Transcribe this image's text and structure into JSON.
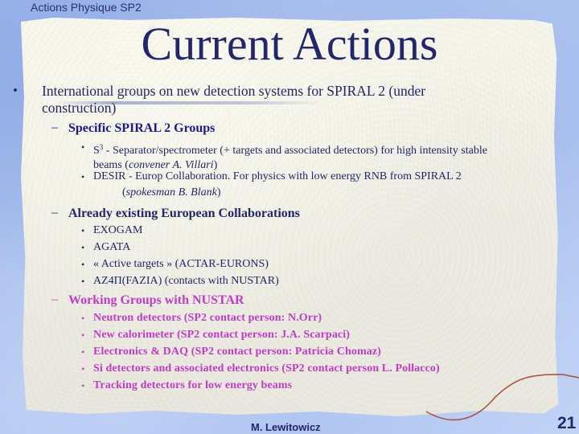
{
  "header": {
    "label": "Actions Physique SP2"
  },
  "title": "Current Actions",
  "main": {
    "bullet": "International groups on new detection systems for SPIRAL 2 (under construction)",
    "bullet_line1": "International groups on new detection systems for SPIRAL 2 (under",
    "bullet_line2": "construction)",
    "sections": [
      {
        "heading": "Specific SPIRAL 2 Groups",
        "color": "#1a1a8c",
        "items": [
          {
            "prefix": "S",
            "sup": "3",
            "text_line1": " - Separator/spectrometer (+ targets and associated detectors) for high intensity stable",
            "text_line2_plain": "beams (",
            "text_line2_italic": "convener A. Villari",
            "text_line2_end": ")"
          },
          {
            "text_line1": "DESIR - Europ Collaboration. For physics with low energy RNB from SPIRAL 2",
            "text_line2_plain": "(",
            "text_line2_italic": "spokesman B. Blank",
            "text_line2_end": ")"
          }
        ]
      },
      {
        "heading": "Already existing European Collaborations",
        "color": "#22266b",
        "items": [
          {
            "text": "EXOGAM"
          },
          {
            "text": "AGATA"
          },
          {
            "text": "« Active targets » (ACTAR-EURONS)"
          },
          {
            "text": "AZ4Π(FAZIA) (contacts with NUSTAR)"
          }
        ]
      },
      {
        "heading": "Working Groups with NUSTAR",
        "color": "#c23cc4",
        "items": [
          {
            "text": "Neutron detectors (SP2 contact person: N.Orr)"
          },
          {
            "text": "New calorimeter (SP2 contact person: J.A. Scarpaci)"
          },
          {
            "text": "Electronics & DAQ (SP2 contact person: Patricia Chomaz)"
          },
          {
            "text": "Si detectors and associated electronics (SP2 contact person  L. Pollacco)"
          },
          {
            "text": "Tracking detectors for low energy beams"
          }
        ]
      }
    ]
  },
  "glyphs": {
    "bullet": "•",
    "dash": "–"
  },
  "footer": {
    "author": "M. Lewitowicz",
    "page_number": "21"
  },
  "colors": {
    "title": "#22266b",
    "accent_blue": "#1a1a8c",
    "accent_magenta": "#c23cc4",
    "background": "#a8bfee",
    "paper": "#f4f3ea"
  }
}
